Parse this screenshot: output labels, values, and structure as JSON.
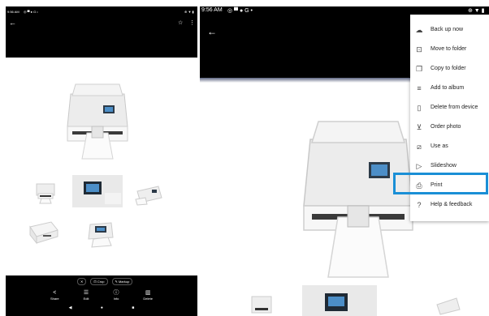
{
  "left_phone": {
    "status_time": "9:56 AM",
    "status_icons_left": "◎ ▀ ● G •",
    "status_icons_right": "⊕ ▼ ▮",
    "chips": [
      {
        "icon": "close-icon",
        "label": "✕"
      },
      {
        "icon": "crop-icon",
        "label": "Crop"
      },
      {
        "icon": "markup-icon",
        "label": "Markup"
      }
    ],
    "actions": [
      {
        "icon": "share-icon",
        "label": "Share"
      },
      {
        "icon": "edit-icon",
        "label": "Edit"
      },
      {
        "icon": "info-icon",
        "label": "Info"
      },
      {
        "icon": "delete-icon",
        "label": "Delete"
      }
    ]
  },
  "right_phone": {
    "status_time": "9:56 AM",
    "status_icons_left": "◎ ▀ ● G •",
    "status_icons_right": "⊕ ▼ ▮"
  },
  "menu": {
    "items": [
      {
        "icon": "cloud-upload-icon",
        "label": "Back up now"
      },
      {
        "icon": "move-to-folder-icon",
        "label": "Move to folder"
      },
      {
        "icon": "copy-to-folder-icon",
        "label": "Copy to folder"
      },
      {
        "icon": "add-to-album-icon",
        "label": "Add to album"
      },
      {
        "icon": "delete-from-device-icon",
        "label": "Delete from device"
      },
      {
        "icon": "cart-icon",
        "label": "Order photo"
      },
      {
        "icon": "use-as-icon",
        "label": "Use as"
      },
      {
        "icon": "slideshow-icon",
        "label": "Slideshow"
      },
      {
        "icon": "print-icon",
        "label": "Print"
      },
      {
        "icon": "help-icon",
        "label": "Help & feedback"
      }
    ],
    "highlighted": "Print",
    "highlight_color": "#1a8fd6"
  }
}
